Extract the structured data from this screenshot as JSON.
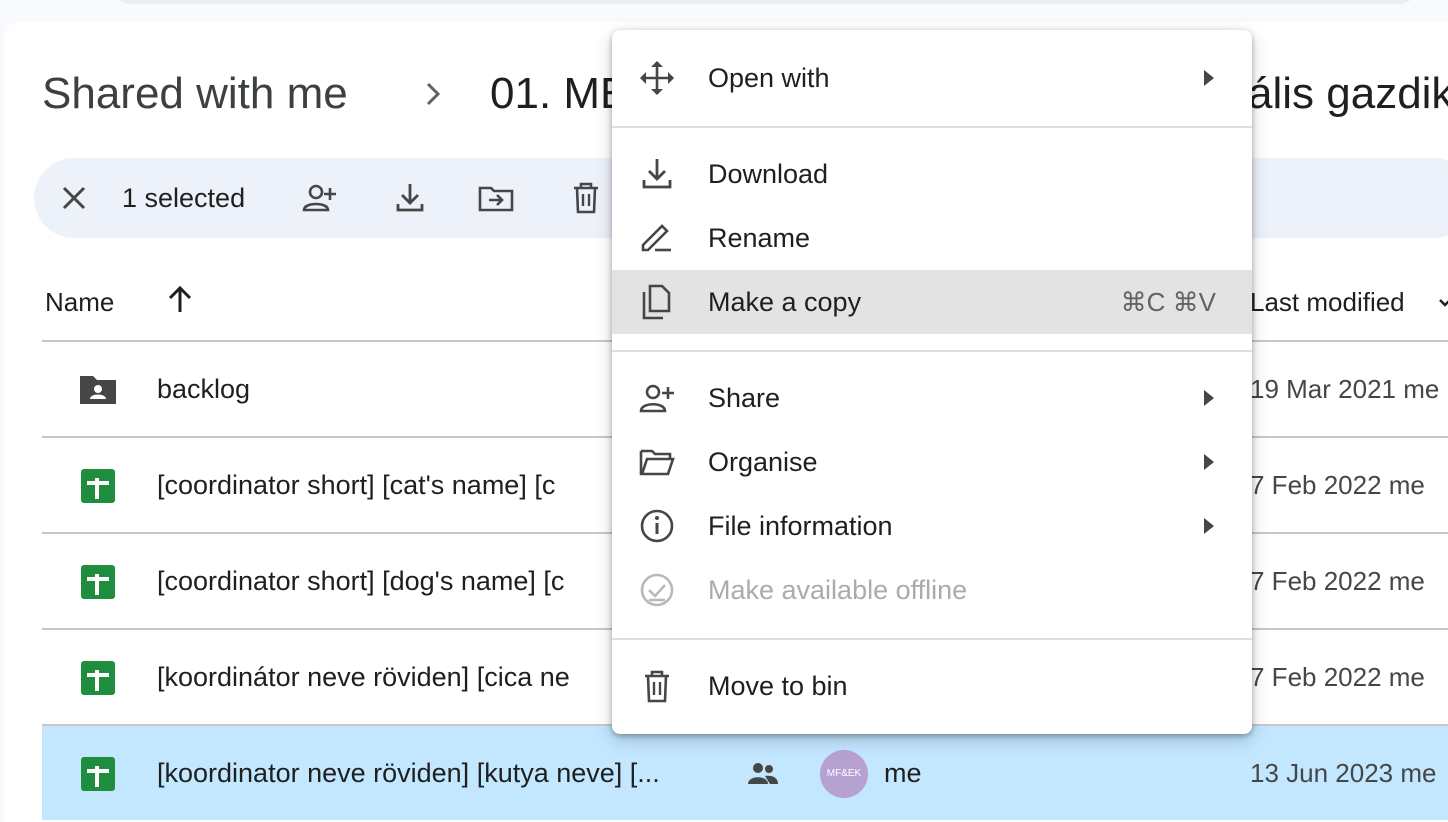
{
  "breadcrumb": {
    "root": "Shared with me",
    "current_visible": "01. ME",
    "current_tail_visible": "ális gazdik"
  },
  "selection_bar": {
    "count_label": "1 selected",
    "actions": [
      "close-icon",
      "share-icon",
      "download-icon",
      "move-icon",
      "trash-icon"
    ]
  },
  "list": {
    "header_name": "Name",
    "header_modified": "Last modified",
    "rows": [
      {
        "name": "backlog",
        "modified": "19 Mar 2021 me",
        "icon": "shared-folder-icon"
      },
      {
        "name": "[coordinator short] [cat's name] [c",
        "modified": "7 Feb 2022 me",
        "icon": "sheets-icon"
      },
      {
        "name": "[coordinator short] [dog's name] [c",
        "modified": "7 Feb 2022 me",
        "icon": "sheets-icon"
      },
      {
        "name": "[koordinátor neve röviden] [cica ne",
        "modified": "7 Feb 2022 me",
        "icon": "sheets-icon"
      },
      {
        "name": "[koordinator neve röviden] [kutya neve] [...",
        "modified": "13 Jun 2023 me",
        "icon": "sheets-icon",
        "owner": "me",
        "avatar_text": "MF&EK",
        "selected": true
      }
    ]
  },
  "context_menu": {
    "open_with": "Open with",
    "download": "Download",
    "rename": "Rename",
    "make_copy": "Make a copy",
    "make_copy_shortcut": "⌘C ⌘V",
    "share": "Share",
    "organise": "Organise",
    "file_information": "File information",
    "make_offline": "Make available offline",
    "move_to_bin": "Move to bin"
  },
  "colors": {
    "selected_row": "#c2e7ff",
    "sheets_green": "#1e8e3e",
    "toolbar_bg": "#edf2fa",
    "hover_item": "#e3e3e3",
    "avatar": "#b7a1d3"
  }
}
